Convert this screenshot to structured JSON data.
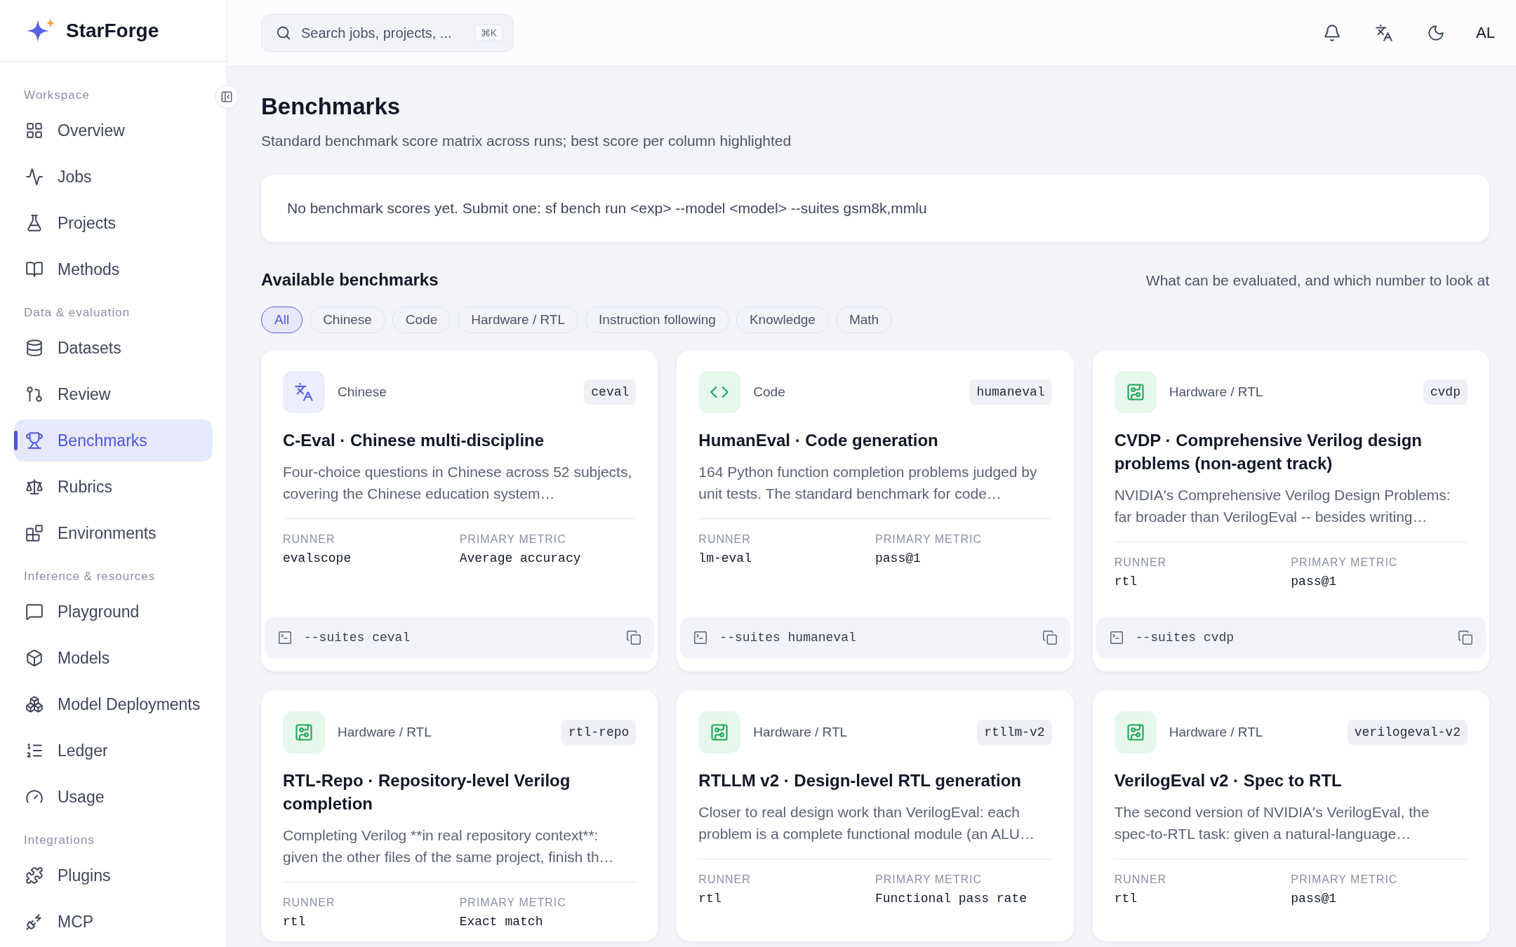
{
  "brand": {
    "name": "StarForge"
  },
  "sidebar": {
    "sections": [
      {
        "title": "Workspace",
        "items": [
          {
            "label": "Overview",
            "selected": false
          },
          {
            "label": "Jobs",
            "selected": false
          },
          {
            "label": "Projects",
            "selected": false
          },
          {
            "label": "Methods",
            "selected": false
          }
        ]
      },
      {
        "title": "Data & evaluation",
        "items": [
          {
            "label": "Datasets",
            "selected": false
          },
          {
            "label": "Review",
            "selected": false
          },
          {
            "label": "Benchmarks",
            "selected": true
          },
          {
            "label": "Rubrics",
            "selected": false
          },
          {
            "label": "Environments",
            "selected": false
          }
        ]
      },
      {
        "title": "Inference & resources",
        "items": [
          {
            "label": "Playground",
            "selected": false
          },
          {
            "label": "Models",
            "selected": false
          },
          {
            "label": "Model Deployments",
            "selected": false
          },
          {
            "label": "Ledger",
            "selected": false
          },
          {
            "label": "Usage",
            "selected": false
          }
        ]
      },
      {
        "title": "Integrations",
        "items": [
          {
            "label": "Plugins",
            "selected": false
          },
          {
            "label": "MCP",
            "selected": false
          }
        ]
      }
    ]
  },
  "topbar": {
    "search": {
      "placeholder": "Search jobs, projects, ...",
      "shortcut": "⌘K"
    },
    "user": "AL"
  },
  "page": {
    "title": "Benchmarks",
    "subtitle": "Standard benchmark score matrix across runs; best score per column highlighted",
    "empty_notice": "No benchmark scores yet. Submit one: sf bench run <exp> --model <model> --suites gsm8k,mmlu"
  },
  "available": {
    "title": "Available benchmarks",
    "hint": "What can be evaluated, and which number to look at",
    "filters": [
      {
        "label": "All",
        "selected": true
      },
      {
        "label": "Chinese",
        "selected": false
      },
      {
        "label": "Code",
        "selected": false
      },
      {
        "label": "Hardware / RTL",
        "selected": false
      },
      {
        "label": "Instruction following",
        "selected": false
      },
      {
        "label": "Knowledge",
        "selected": false
      },
      {
        "label": "Math",
        "selected": false
      }
    ],
    "cards": [
      {
        "kind": "language",
        "category": "Chinese",
        "tag": "ceval",
        "title": "C-Eval · Chinese multi-discipline",
        "description": "Four-choice questions in Chinese across 52 subjects, covering the Chinese education system…",
        "runner_label": "RUNNER",
        "runner": "evalscope",
        "metric_label": "PRIMARY METRIC",
        "metric": "Average accuracy",
        "command": "--suites ceval"
      },
      {
        "kind": "code",
        "category": "Code",
        "tag": "humaneval",
        "title": "HumanEval · Code generation",
        "description": "164 Python function completion problems judged by unit tests. The standard benchmark for code…",
        "runner_label": "RUNNER",
        "runner": "lm-eval",
        "metric_label": "PRIMARY METRIC",
        "metric": "pass@1",
        "command": "--suites humaneval"
      },
      {
        "kind": "hardware",
        "category": "Hardware / RTL",
        "tag": "cvdp",
        "title": "CVDP · Comprehensive Verilog design problems (non-agent track)",
        "description": "NVIDIA's Comprehensive Verilog Design Problems: far broader than VerilogEval -- besides writing…",
        "runner_label": "RUNNER",
        "runner": "rtl",
        "metric_label": "PRIMARY METRIC",
        "metric": "pass@1",
        "command": "--suites cvdp"
      },
      {
        "kind": "hardware",
        "category": "Hardware / RTL",
        "tag": "rtl-repo",
        "title": "RTL-Repo · Repository-level Verilog completion",
        "description": "Completing Verilog **in real repository context**: given the other files of the same project, finish th…",
        "runner_label": "RUNNER",
        "runner": "rtl",
        "metric_label": "PRIMARY METRIC",
        "metric": "Exact match"
      },
      {
        "kind": "hardware",
        "category": "Hardware / RTL",
        "tag": "rtllm-v2",
        "title": "RTLLM v2 · Design-level RTL generation",
        "description": "Closer to real design work than VerilogEval: each problem is a complete functional module (an ALU…",
        "runner_label": "RUNNER",
        "runner": "rtl",
        "metric_label": "PRIMARY METRIC",
        "metric": "Functional pass rate"
      },
      {
        "kind": "hardware",
        "category": "Hardware / RTL",
        "tag": "verilogeval-v2",
        "title": "VerilogEval v2 · Spec to RTL",
        "description": "The second version of NVIDIA's VerilogEval, the spec-to-RTL task: given a natural-language…",
        "runner_label": "RUNNER",
        "runner": "rtl",
        "metric_label": "PRIMARY METRIC",
        "metric": "pass@1"
      }
    ]
  }
}
